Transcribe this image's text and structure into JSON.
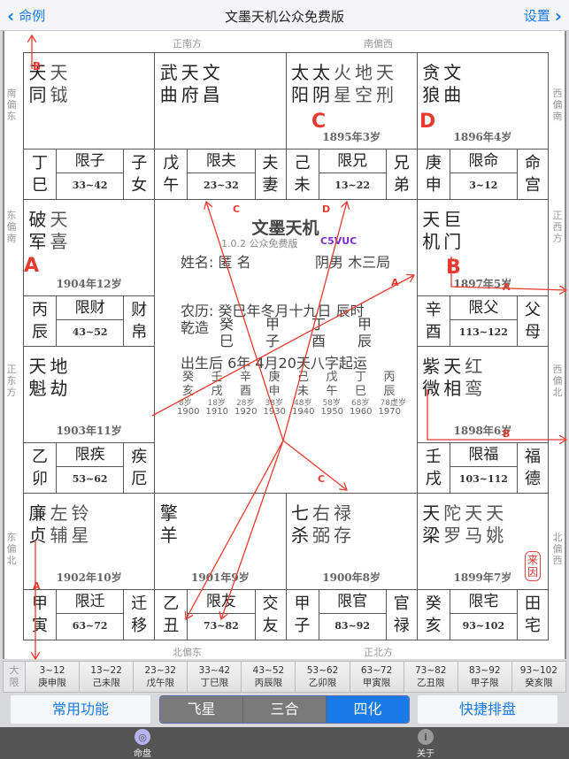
{
  "navbar": {
    "back_label": "命例",
    "title": "文墨天机公众免费版",
    "forward_label": "设置"
  },
  "directions": {
    "top": [
      "正南方",
      "南偏西"
    ],
    "bottom": [
      "北偏东",
      "正北方"
    ],
    "left": [
      "南偏东",
      "东偏南",
      "正东方",
      "东偏北"
    ],
    "right": [
      "西偏南",
      "正西方",
      "西偏北",
      "北偏西"
    ]
  },
  "palaces": [
    {
      "id": "si",
      "stars": [
        [
          "天",
          "同"
        ],
        [
          "天",
          "钺"
        ]
      ],
      "minor_from": 1,
      "year": "",
      "ganzhi": [
        "丁",
        "巳"
      ],
      "limit": "限子",
      "ages": "33~42",
      "name": [
        "子",
        "女"
      ]
    },
    {
      "id": "wu",
      "stars": [
        [
          "武",
          "曲"
        ],
        [
          "天",
          "府"
        ],
        [
          "文",
          "昌"
        ]
      ],
      "minor_from": 3,
      "year": "",
      "ganzhi": [
        "戊",
        "午"
      ],
      "limit": "限夫",
      "ages": "23~32",
      "name": [
        "夫",
        "妻"
      ]
    },
    {
      "id": "wei",
      "stars": [
        [
          "太",
          "阳"
        ],
        [
          "太",
          "阴"
        ],
        [
          "火",
          "星"
        ],
        [
          "地",
          "空"
        ],
        [
          "天",
          "刑"
        ]
      ],
      "minor_from": 2,
      "year": "1895年3岁",
      "ganzhi": [
        "己",
        "未"
      ],
      "limit": "限兄",
      "ages": "13~22",
      "name": [
        "兄",
        "弟"
      ]
    },
    {
      "id": "shen",
      "stars": [
        [
          "贪",
          "狼"
        ],
        [
          "文",
          "曲"
        ]
      ],
      "minor_from": 2,
      "year": "1896年4岁",
      "ganzhi": [
        "庚",
        "申"
      ],
      "limit": "限命",
      "ages": "3~12",
      "name": [
        "命",
        "宫"
      ]
    },
    {
      "id": "chen",
      "stars": [
        [
          "破",
          "军"
        ],
        [
          "天",
          "喜"
        ]
      ],
      "minor_from": 1,
      "year": "1904年12岁",
      "ganzhi": [
        "丙",
        "辰"
      ],
      "limit": "限财",
      "ages": "43~52",
      "name": [
        "财",
        "帛"
      ]
    },
    {
      "id": "you",
      "stars": [
        [
          "天",
          "机"
        ],
        [
          "巨",
          "门"
        ]
      ],
      "minor_from": 2,
      "year": "1897年5岁",
      "ganzhi": [
        "辛",
        "酉"
      ],
      "limit": "限父",
      "ages": "113~122",
      "name": [
        "父",
        "母"
      ]
    },
    {
      "id": "mao",
      "stars": [
        [
          "天",
          "魁"
        ],
        [
          "地",
          "劫"
        ]
      ],
      "minor_from": 0,
      "year": "1903年11岁",
      "ganzhi": [
        "乙",
        "卯"
      ],
      "limit": "限疾",
      "ages": "53~62",
      "name": [
        "疾",
        "厄"
      ]
    },
    {
      "id": "xu",
      "stars": [
        [
          "紫",
          "微"
        ],
        [
          "天",
          "相"
        ],
        [
          "红",
          "鸾"
        ]
      ],
      "minor_from": 2,
      "year": "1898年6岁",
      "ganzhi": [
        "壬",
        "戌"
      ],
      "limit": "限福",
      "ages": "103~112",
      "name": [
        "福",
        "德"
      ]
    },
    {
      "id": "yin",
      "stars": [
        [
          "廉",
          "贞"
        ],
        [
          "左",
          "辅"
        ],
        [
          "铃",
          "星"
        ]
      ],
      "minor_from": 1,
      "year": "1902年10岁",
      "ganzhi": [
        "甲",
        "寅"
      ],
      "limit": "限迁",
      "ages": "63~72",
      "name": [
        "迁",
        "移"
      ]
    },
    {
      "id": "chou",
      "stars": [
        [
          "擎",
          "羊"
        ]
      ],
      "minor_from": 0,
      "year": "1901年9岁",
      "ganzhi": [
        "乙",
        "丑"
      ],
      "limit": "限友",
      "ages": "73~82",
      "name": [
        "交",
        "友"
      ]
    },
    {
      "id": "zi",
      "stars": [
        [
          "七",
          "杀"
        ],
        [
          "右",
          "弼"
        ],
        [
          "禄",
          "存"
        ]
      ],
      "minor_from": 1,
      "year": "1900年8岁",
      "ganzhi": [
        "甲",
        "子"
      ],
      "limit": "限官",
      "ages": "83~92",
      "name": [
        "官",
        "禄"
      ]
    },
    {
      "id": "hai",
      "stars": [
        [
          "天",
          "梁"
        ],
        [
          "陀",
          "罗"
        ],
        [
          "天",
          "马"
        ],
        [
          "天",
          "姚"
        ]
      ],
      "minor_from": 1,
      "year": "1899年7岁",
      "ganzhi": [
        "癸",
        "亥"
      ],
      "limit": "限宅",
      "ages": "93~102",
      "name": [
        "田",
        "宅"
      ],
      "badge": [
        "来",
        "因"
      ]
    }
  ],
  "center": {
    "app_name": "文墨天机",
    "version": "1.0.2 公众免费版",
    "code": "C5VUC",
    "name_line": "姓名: 匿 名",
    "gender_line": "阴男 木三局",
    "lunar": "农历: 癸巳年冬月十九日 辰时",
    "qianzao_label": "乾造",
    "bazi_top": [
      "癸",
      "甲",
      "丁",
      "甲"
    ],
    "bazi_bottom": [
      "巳",
      "子",
      "酉",
      "辰"
    ],
    "qiyun": "出生后 6年 4月20天八字起运",
    "dayun_top": [
      "癸",
      "壬",
      "辛",
      "庚",
      "己",
      "戊",
      "丁",
      "丙"
    ],
    "dayun_bottom": [
      "亥",
      "戌",
      "酉",
      "申",
      "未",
      "午",
      "巳",
      "辰"
    ],
    "dayun_ages": [
      "8岁",
      "18岁",
      "28岁",
      "38岁",
      "48岁",
      "58岁",
      "68岁",
      "78虚岁"
    ],
    "dayun_years": [
      "1900",
      "1910",
      "1920",
      "1930",
      "1940",
      "1950",
      "1960",
      "1970"
    ]
  },
  "sihua_marks": {
    "A": "A",
    "B": "B",
    "C": "C",
    "D": "D"
  },
  "daxian": {
    "label": [
      "大",
      "限"
    ],
    "items": [
      {
        "ages": "3~12",
        "gz": "庚申限"
      },
      {
        "ages": "13~22",
        "gz": "己未限"
      },
      {
        "ages": "23~32",
        "gz": "戊午限"
      },
      {
        "ages": "33~42",
        "gz": "丁巳限"
      },
      {
        "ages": "43~52",
        "gz": "丙辰限"
      },
      {
        "ages": "53~62",
        "gz": "乙卯限"
      },
      {
        "ages": "63~72",
        "gz": "甲寅限"
      },
      {
        "ages": "73~82",
        "gz": "乙丑限"
      },
      {
        "ages": "83~92",
        "gz": "甲子限"
      },
      {
        "ages": "93~102",
        "gz": "癸亥限"
      }
    ]
  },
  "toolbar": {
    "common_label": "常用功能",
    "segments": [
      "飞星",
      "三合",
      "四化"
    ],
    "active_segment": "四化",
    "quick_label": "快捷排盘"
  },
  "tabbar": {
    "items": [
      {
        "label": "命盘",
        "icon": "disc-icon",
        "active": true
      },
      {
        "label": "关于",
        "icon": "info-icon",
        "active": false
      }
    ]
  },
  "colors": {
    "accent": "#1a7ae8",
    "mark_red": "#e83a30",
    "border": "#555555"
  }
}
